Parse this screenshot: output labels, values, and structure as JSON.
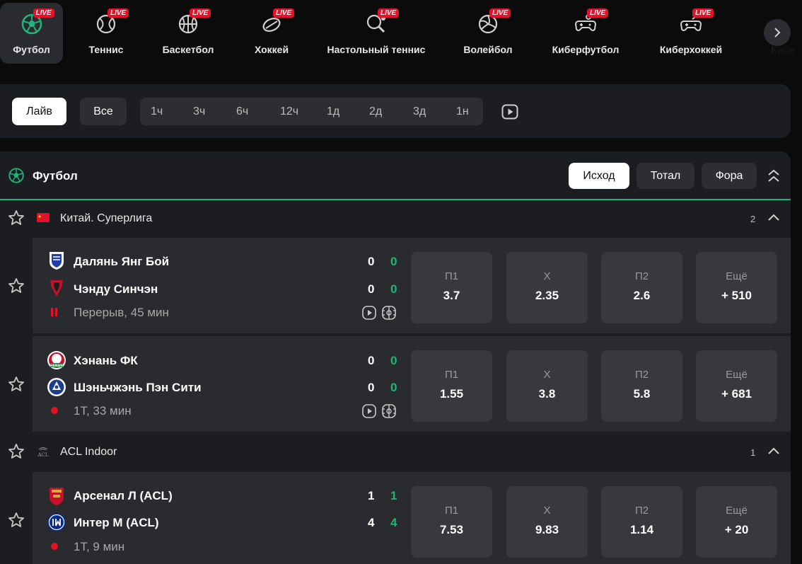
{
  "sports": [
    {
      "label": "Футбол",
      "live": "LIVE",
      "icon": "football-icon"
    },
    {
      "label": "Теннис",
      "live": "LIVE",
      "icon": "tennis-icon"
    },
    {
      "label": "Баскетбол",
      "live": "LIVE",
      "icon": "basketball-icon"
    },
    {
      "label": "Хоккей",
      "live": "LIVE",
      "icon": "hockey-icon"
    },
    {
      "label": "Настольный теннис",
      "live": "LIVE",
      "icon": "table-tennis-icon"
    },
    {
      "label": "Волейбол",
      "live": "LIVE",
      "icon": "volleyball-icon"
    },
    {
      "label": "Киберфутбол",
      "live": "LIVE",
      "icon": "gamepad-icon"
    },
    {
      "label": "Киберхоккей",
      "live": "LIVE",
      "icon": "gamepad-icon"
    },
    {
      "label": "Кибе",
      "live": "",
      "icon": ""
    }
  ],
  "filters": {
    "live_label": "Лайв",
    "all_label": "Все",
    "ranges": [
      "1ч",
      "3ч",
      "6ч",
      "12ч",
      "1д",
      "2д",
      "3д",
      "1н"
    ]
  },
  "section": {
    "title": "Футбол",
    "markets": [
      "Исход",
      "Тотал",
      "Фора"
    ]
  },
  "leagues": [
    {
      "name": "Китай. Суперлига",
      "count": "2"
    },
    {
      "name": "ACL Indoor",
      "count": "1",
      "emblem_text": "ACL"
    }
  ],
  "matches": [
    {
      "team1": "Далянь Янг Бой",
      "team2": "Чэнду Синчэн",
      "score1a": "0",
      "score1b": "0",
      "score2a": "0",
      "score2b": "0",
      "status": "Перерыв, 45 мин",
      "odds": [
        {
          "h": "П1",
          "v": "3.7"
        },
        {
          "h": "Х",
          "v": "2.35"
        },
        {
          "h": "П2",
          "v": "2.6"
        },
        {
          "h": "Ещё",
          "v": "+ 510"
        }
      ]
    },
    {
      "team1": "Хэнань ФК",
      "team2": "Шэньчжэнь Пэн Сити",
      "score1a": "0",
      "score1b": "0",
      "score2a": "0",
      "score2b": "0",
      "status": "1Т, 33 мин",
      "logo_text": "HENAN",
      "odds": [
        {
          "h": "П1",
          "v": "1.55"
        },
        {
          "h": "Х",
          "v": "3.8"
        },
        {
          "h": "П2",
          "v": "5.8"
        },
        {
          "h": "Ещё",
          "v": "+ 681"
        }
      ]
    },
    {
      "team1": "Арсенал Л (ACL)",
      "team2": "Интер М (ACL)",
      "score1a": "1",
      "score1b": "1",
      "score2a": "4",
      "score2b": "4",
      "status": "1Т, 9 мин",
      "odds": [
        {
          "h": "П1",
          "v": "7.53"
        },
        {
          "h": "Х",
          "v": "9.83"
        },
        {
          "h": "П2",
          "v": "1.14"
        },
        {
          "h": "Ещё",
          "v": "+ 20"
        }
      ]
    }
  ],
  "colors": {
    "accent": "#1fb57a",
    "live": "#e3122a"
  }
}
